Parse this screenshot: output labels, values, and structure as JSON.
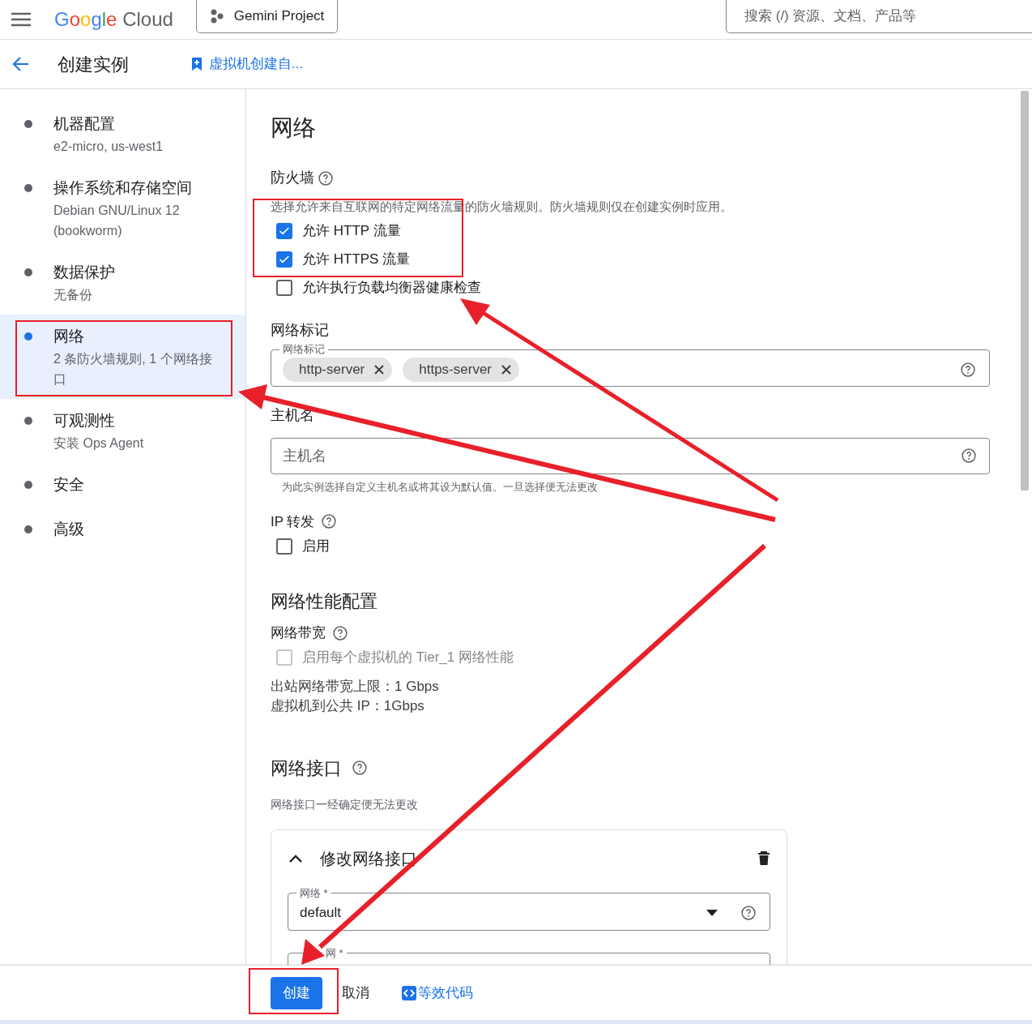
{
  "header": {
    "logo_brand": "Google",
    "logo_product": "Cloud",
    "project": "Gemini Project",
    "search": {
      "placeholder": "搜索 (/) 资源、文档、产品等"
    }
  },
  "page": {
    "title": "创建实例",
    "link": "虚拟机创建自..."
  },
  "sidebar": {
    "items": [
      {
        "title": "机器配置",
        "subtitle": "e2-micro, us-west1",
        "selected": false
      },
      {
        "title": "操作系统和存储空间",
        "subtitle": "Debian GNU/Linux 12 (bookworm)",
        "selected": false
      },
      {
        "title": "数据保护",
        "subtitle": "无备份",
        "selected": false
      },
      {
        "title": "网络",
        "subtitle": "2 条防火墙规则, 1 个网络接口",
        "selected": true
      },
      {
        "title": "可观测性",
        "subtitle": "安装 Ops Agent",
        "selected": false
      },
      {
        "title": "安全",
        "selected": false
      },
      {
        "title": "高级",
        "selected": false
      }
    ]
  },
  "main": {
    "title": "网络",
    "firewall": {
      "label": "防火墙",
      "description": "选择允许来自互联网的特定网络流量的防火墙规则。防火墙规则仅在创建实例时应用。",
      "options": [
        {
          "label": "允许 HTTP 流量",
          "checked": true
        },
        {
          "label": "允许 HTTPS 流量",
          "checked": true
        },
        {
          "label": "允许执行负载均衡器健康检查",
          "checked": false
        }
      ]
    },
    "network_tags": {
      "label": "网络标记",
      "field_label": "网络标记",
      "tags": [
        "http-server",
        "https-server"
      ]
    },
    "hostname": {
      "label": "主机名",
      "placeholder": "主机名",
      "hint": "为此实例选择自定义主机名或将其设为默认值。一旦选择便无法更改"
    },
    "ip_forwarding": {
      "label": "IP 转发",
      "option": {
        "label": "启用",
        "checked": false
      }
    },
    "performance": {
      "title": "网络性能配置",
      "bandwidth_label": "网络带宽",
      "option": {
        "label": "启用每个虚拟机的 Tier_1 网络性能",
        "checked": false,
        "disabled": true
      },
      "lines": [
        "出站网络带宽上限：1 Gbps",
        "虚拟机到公共 IP：1Gbps"
      ]
    },
    "interfaces": {
      "title": "网络接口",
      "description": "网络接口一经确定便无法更改",
      "card": {
        "title": "修改网络接口",
        "expanded": true,
        "network_field": {
          "label": "网络 *",
          "value": "default"
        },
        "subnet_field": {
          "label": "网 *"
        }
      }
    }
  },
  "footer": {
    "create": "创建",
    "cancel": "取消",
    "code_link": "等效代码"
  }
}
